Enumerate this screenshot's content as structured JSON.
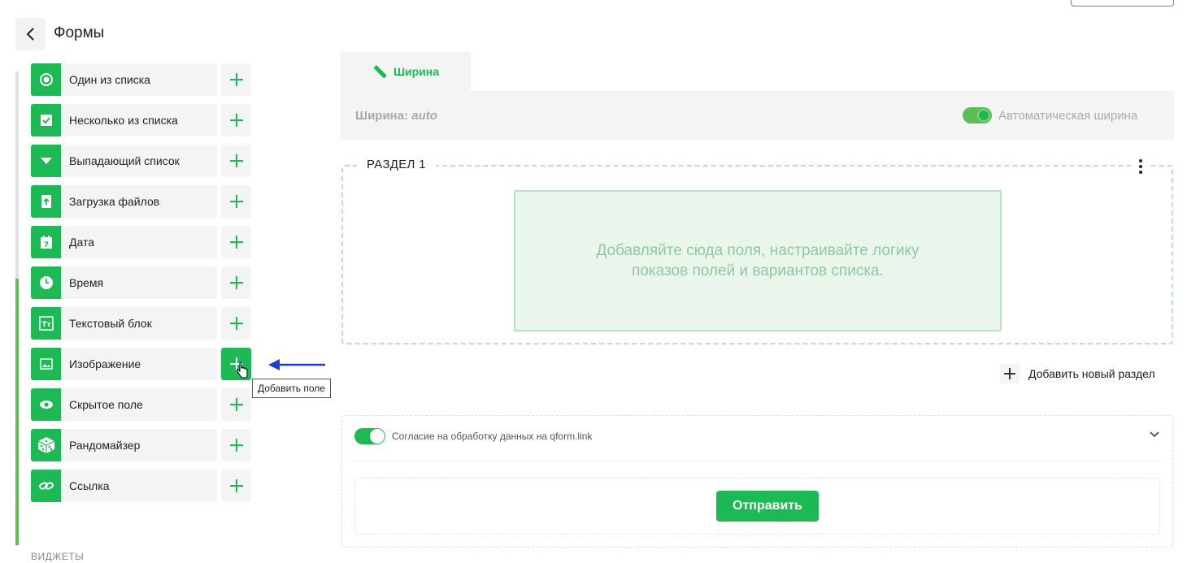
{
  "header": {
    "title": "Формы"
  },
  "fields": [
    {
      "label": "Один из списка",
      "icon": "radio-icon"
    },
    {
      "label": "Несколько из списка",
      "icon": "checkbox-icon"
    },
    {
      "label": "Выпадающий список",
      "icon": "dropdown-icon"
    },
    {
      "label": "Загрузка файлов",
      "icon": "file-upload-icon"
    },
    {
      "label": "Дата",
      "icon": "calendar-icon"
    },
    {
      "label": "Время",
      "icon": "clock-icon"
    },
    {
      "label": "Текстовый блок",
      "icon": "text-block-icon"
    },
    {
      "label": "Изображение",
      "icon": "image-icon"
    },
    {
      "label": "Скрытое поле",
      "icon": "eye-icon"
    },
    {
      "label": "Рандомайзер",
      "icon": "dice-icon"
    },
    {
      "label": "Ссылка",
      "icon": "link-icon"
    }
  ],
  "tooltip": {
    "text": "Добавить поле"
  },
  "sidebar": {
    "widgets_heading": "ВИДЖЕТЫ"
  },
  "tabs": {
    "width_tab": "Ширина"
  },
  "width_settings": {
    "label": "Ширина:",
    "value": "auto",
    "auto_width_label": "Автоматическая ширина",
    "auto_width_on": true
  },
  "section": {
    "title": "РАЗДЕЛ 1",
    "placeholder": "Добавляйте сюда поля, настраивайте логику показов полей и вариантов списка."
  },
  "add_section": {
    "label": "Добавить новый раздел"
  },
  "consent": {
    "label": "Согласие на обработку данных на qform.link",
    "enabled": true
  },
  "submit": {
    "label": "Отправить"
  },
  "colors": {
    "accent": "#1db954",
    "dropzone_bg": "#eaf5ec",
    "arrow": "#1a3fd6"
  }
}
